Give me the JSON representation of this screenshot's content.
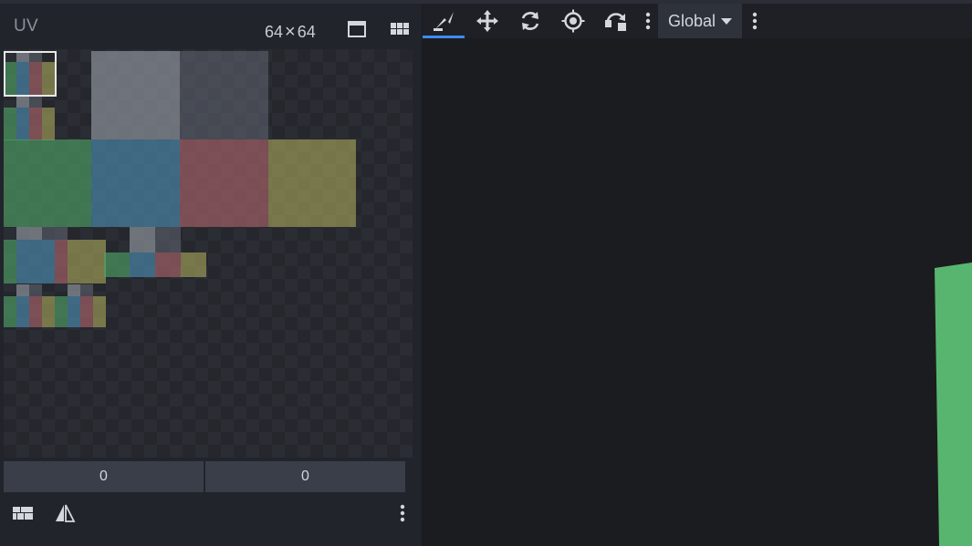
{
  "uv_panel": {
    "title": "UV",
    "texture_width": "64",
    "texture_height": "64",
    "times_sign": "×",
    "coord_u": "0",
    "coord_v": "0"
  },
  "viewport": {
    "space_label": "Global"
  },
  "icons": {
    "frame": "window-frame-icon",
    "grid": "grid-icon",
    "layout": "uv-layout-icon",
    "mirror": "mirror-icon",
    "more": "vertical-dots-icon",
    "pivot": "pivot-tool-icon",
    "move": "move-tool-icon",
    "rotate": "rotate-tool-icon",
    "target": "target-tool-icon",
    "flip": "flip-tool-icon"
  },
  "colors": {
    "panel_bg": "#21242b",
    "viewport_bg": "#1b1c1f",
    "accent": "#3d8cf0",
    "face_green": "#4fa768",
    "face_blue": "#4d8fb7",
    "face_red": "#b0666c",
    "face_yellow": "#a8a65a",
    "face_light_gray": "#9aa0a8",
    "face_dark_gray": "#5b606b",
    "model_green": "#58b56f"
  }
}
